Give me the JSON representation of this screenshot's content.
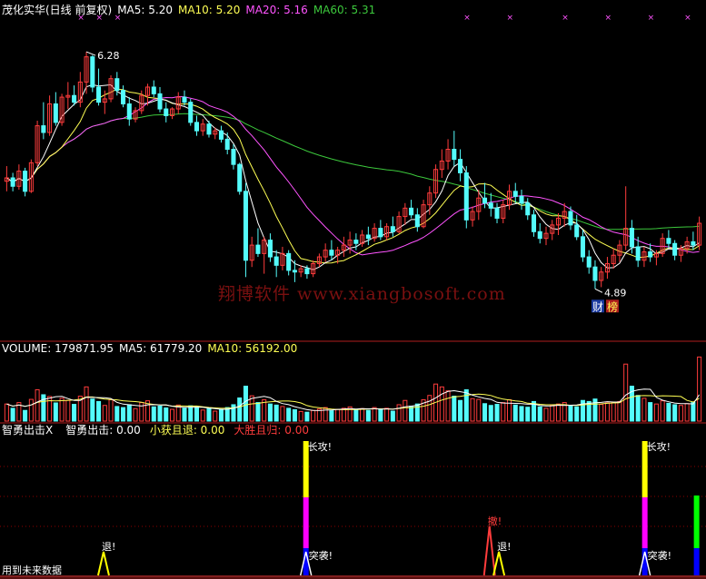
{
  "header": {
    "main": {
      "title": "茂化实华(日线 前复权)",
      "ma5": "MA5: 5.20",
      "ma10": "MA10: 5.20",
      "ma20": "MA20: 5.16",
      "ma60": "MA60: 5.31"
    },
    "volume": {
      "title": "VOLUME: 179871.95",
      "ma5": "MA5: 61779.20",
      "ma10": "MA10: 56192.00"
    },
    "indicator": {
      "title": "智勇出击X",
      "v1": "智勇出击: 0.00",
      "v2": "小获且退: 0.00",
      "v3": "大胜且归: 0.00"
    }
  },
  "watermark": "翔博软件 www.xiangbosoft.com",
  "footer_text": "用到未来数据",
  "colors": {
    "up": "#ff3c3c",
    "down": "#54fcfc",
    "ma5": "#ffffff",
    "ma10": "#ffff54",
    "ma20": "#ff54ff",
    "ma60": "#3cc83c",
    "grid": "#8b0000",
    "divider": "#b01e1e",
    "signal_yellow": "#ffff00",
    "signal_magenta": "#ff00ff",
    "signal_green": "#00ff00",
    "signal_blue": "#0000ff"
  },
  "chart_data": [
    {
      "type": "candlestick",
      "title": "茂化实华(日线 前复权)",
      "ylim": [
        4.6,
        6.5
      ],
      "series_lines": [
        "MA5",
        "MA10",
        "MA20",
        "MA60"
      ],
      "annotations": [
        {
          "text": "6.28",
          "kind": "high_marker",
          "value": 6.28
        },
        {
          "text": "4.89",
          "kind": "low_marker",
          "value": 4.89
        },
        {
          "text": "财",
          "kind": "tag"
        },
        {
          "text": "榜",
          "kind": "tag"
        }
      ],
      "candles_ohlc": [
        [
          5.53,
          5.62,
          5.47,
          5.55
        ],
        [
          5.55,
          5.58,
          5.47,
          5.5
        ],
        [
          5.5,
          5.63,
          5.48,
          5.59
        ],
        [
          5.59,
          5.61,
          5.44,
          5.47
        ],
        [
          5.47,
          5.66,
          5.46,
          5.64
        ],
        [
          5.64,
          5.89,
          5.62,
          5.86
        ],
        [
          5.86,
          6.0,
          5.78,
          5.82
        ],
        [
          5.82,
          6.04,
          5.8,
          5.99
        ],
        [
          5.99,
          6.06,
          5.86,
          5.88
        ],
        [
          5.88,
          6.05,
          5.86,
          6.03
        ],
        [
          6.03,
          6.12,
          5.96,
          6.04
        ],
        [
          6.04,
          6.1,
          5.98,
          6.0
        ],
        [
          6.0,
          6.18,
          5.97,
          6.12
        ],
        [
          6.12,
          6.3,
          6.05,
          6.27
        ],
        [
          6.27,
          6.28,
          6.06,
          6.09
        ],
        [
          6.09,
          6.2,
          5.98,
          6.0
        ],
        [
          6.0,
          6.07,
          5.93,
          6.02
        ],
        [
          6.02,
          6.16,
          6.0,
          6.14
        ],
        [
          6.14,
          6.18,
          6.04,
          6.07
        ],
        [
          6.07,
          6.1,
          5.97,
          5.99
        ],
        [
          5.99,
          6.03,
          5.86,
          5.9
        ],
        [
          5.9,
          5.97,
          5.88,
          5.95
        ],
        [
          5.95,
          6.07,
          5.93,
          6.04
        ],
        [
          6.04,
          6.11,
          5.98,
          6.09
        ],
        [
          6.09,
          6.13,
          6.03,
          6.05
        ],
        [
          6.05,
          6.09,
          5.94,
          5.96
        ],
        [
          5.96,
          6.0,
          5.88,
          5.92
        ],
        [
          5.92,
          5.97,
          5.9,
          5.96
        ],
        [
          5.96,
          6.06,
          5.93,
          6.03
        ],
        [
          6.03,
          6.07,
          5.98,
          6.0
        ],
        [
          6.0,
          6.02,
          5.86,
          5.88
        ],
        [
          5.88,
          5.92,
          5.8,
          5.83
        ],
        [
          5.83,
          5.9,
          5.8,
          5.87
        ],
        [
          5.87,
          5.89,
          5.79,
          5.81
        ],
        [
          5.81,
          5.85,
          5.78,
          5.83
        ],
        [
          5.83,
          5.86,
          5.76,
          5.78
        ],
        [
          5.78,
          5.82,
          5.69,
          5.72
        ],
        [
          5.72,
          5.75,
          5.6,
          5.63
        ],
        [
          5.63,
          5.64,
          5.45,
          5.47
        ],
        [
          5.47,
          5.52,
          4.96,
          5.06
        ],
        [
          5.06,
          5.2,
          5.02,
          5.15
        ],
        [
          5.15,
          5.25,
          5.08,
          5.1
        ],
        [
          5.1,
          5.2,
          4.98,
          5.18
        ],
        [
          5.18,
          5.22,
          5.05,
          5.08
        ],
        [
          5.08,
          5.12,
          4.96,
          5.03
        ],
        [
          5.03,
          5.14,
          5.0,
          5.1
        ],
        [
          5.1,
          5.12,
          4.97,
          5.0
        ],
        [
          5.0,
          5.06,
          4.93,
          4.99
        ],
        [
          4.99,
          5.03,
          4.96,
          5.01
        ],
        [
          5.01,
          5.03,
          4.95,
          4.98
        ],
        [
          4.98,
          5.06,
          4.96,
          5.04
        ],
        [
          5.04,
          5.1,
          5.02,
          5.08
        ],
        [
          5.08,
          5.16,
          5.05,
          5.12
        ],
        [
          5.12,
          5.18,
          5.06,
          5.09
        ],
        [
          5.09,
          5.14,
          5.04,
          5.12
        ],
        [
          5.12,
          5.2,
          5.08,
          5.15
        ],
        [
          5.15,
          5.23,
          5.1,
          5.18
        ],
        [
          5.18,
          5.22,
          5.12,
          5.16
        ],
        [
          5.16,
          5.24,
          5.14,
          5.21
        ],
        [
          5.21,
          5.26,
          5.15,
          5.19
        ],
        [
          5.19,
          5.28,
          5.17,
          5.25
        ],
        [
          5.25,
          5.3,
          5.18,
          5.2
        ],
        [
          5.2,
          5.28,
          5.18,
          5.26
        ],
        [
          5.26,
          5.32,
          5.2,
          5.23
        ],
        [
          5.23,
          5.35,
          5.22,
          5.32
        ],
        [
          5.32,
          5.4,
          5.27,
          5.37
        ],
        [
          5.37,
          5.42,
          5.31,
          5.33
        ],
        [
          5.33,
          5.37,
          5.23,
          5.26
        ],
        [
          5.26,
          5.42,
          5.25,
          5.39
        ],
        [
          5.39,
          5.5,
          5.33,
          5.46
        ],
        [
          5.46,
          5.63,
          5.43,
          5.6
        ],
        [
          5.6,
          5.72,
          5.55,
          5.65
        ],
        [
          5.65,
          5.78,
          5.6,
          5.72
        ],
        [
          5.72,
          5.83,
          5.62,
          5.66
        ],
        [
          5.66,
          5.72,
          5.53,
          5.58
        ],
        [
          5.58,
          5.62,
          5.25,
          5.3
        ],
        [
          5.3,
          5.38,
          5.26,
          5.35
        ],
        [
          5.35,
          5.48,
          5.3,
          5.43
        ],
        [
          5.43,
          5.52,
          5.37,
          5.4
        ],
        [
          5.4,
          5.46,
          5.32,
          5.37
        ],
        [
          5.37,
          5.4,
          5.28,
          5.31
        ],
        [
          5.31,
          5.42,
          5.28,
          5.39
        ],
        [
          5.39,
          5.51,
          5.36,
          5.47
        ],
        [
          5.47,
          5.52,
          5.4,
          5.44
        ],
        [
          5.44,
          5.48,
          5.36,
          5.4
        ],
        [
          5.4,
          5.43,
          5.3,
          5.33
        ],
        [
          5.33,
          5.36,
          5.2,
          5.23
        ],
        [
          5.23,
          5.28,
          5.16,
          5.19
        ],
        [
          5.19,
          5.26,
          5.15,
          5.22
        ],
        [
          5.22,
          5.3,
          5.18,
          5.27
        ],
        [
          5.27,
          5.34,
          5.21,
          5.31
        ],
        [
          5.31,
          5.4,
          5.26,
          5.35
        ],
        [
          5.35,
          5.38,
          5.24,
          5.27
        ],
        [
          5.27,
          5.33,
          5.18,
          5.2
        ],
        [
          5.2,
          5.24,
          5.05,
          5.08
        ],
        [
          5.08,
          5.12,
          4.98,
          5.02
        ],
        [
          5.02,
          5.06,
          4.89,
          4.94
        ],
        [
          4.94,
          5.02,
          4.9,
          4.99
        ],
        [
          4.99,
          5.08,
          4.95,
          5.04
        ],
        [
          5.04,
          5.13,
          5.01,
          5.09
        ],
        [
          5.09,
          5.18,
          5.05,
          5.15
        ],
        [
          5.15,
          5.5,
          5.12,
          5.25
        ],
        [
          5.25,
          5.3,
          5.1,
          5.14
        ],
        [
          5.14,
          5.2,
          5.02,
          5.06
        ],
        [
          5.06,
          5.14,
          5.02,
          5.11
        ],
        [
          5.11,
          5.16,
          5.05,
          5.08
        ],
        [
          5.08,
          5.12,
          5.03,
          5.1
        ],
        [
          5.1,
          5.22,
          5.08,
          5.19
        ],
        [
          5.19,
          5.24,
          5.13,
          5.16
        ],
        [
          5.16,
          5.18,
          5.06,
          5.09
        ],
        [
          5.09,
          5.15,
          5.05,
          5.13
        ],
        [
          5.13,
          5.2,
          5.1,
          5.17
        ],
        [
          5.17,
          5.23,
          5.12,
          5.15
        ],
        [
          5.15,
          5.32,
          5.12,
          5.28
        ]
      ]
    },
    {
      "type": "bar",
      "title": "VOLUME: 179871.95",
      "series_lines": [
        "MA5",
        "MA10"
      ],
      "values": [
        48000,
        36000,
        52000,
        30000,
        61000,
        88000,
        74000,
        69000,
        51000,
        64000,
        58000,
        47000,
        70000,
        96000,
        62000,
        55000,
        44000,
        60000,
        41000,
        38000,
        46000,
        35000,
        52000,
        57000,
        40000,
        42000,
        37000,
        33000,
        45000,
        36000,
        43000,
        39000,
        31000,
        35000,
        28000,
        33000,
        38000,
        46000,
        65000,
        98000,
        71000,
        52000,
        60000,
        48000,
        45000,
        41000,
        36000,
        32000,
        27000,
        25000,
        30000,
        34000,
        38000,
        29000,
        33000,
        36000,
        40000,
        31000,
        35000,
        30000,
        38000,
        33000,
        36000,
        28000,
        46000,
        58000,
        42000,
        48000,
        60000,
        72000,
        104000,
        96000,
        85000,
        70000,
        58000,
        88000,
        63000,
        61000,
        49000,
        44000,
        47000,
        52000,
        60000,
        45000,
        41000,
        39000,
        55000,
        40000,
        36000,
        44000,
        48000,
        52000,
        43000,
        40000,
        58000,
        55000,
        62000,
        47000,
        51000,
        53000,
        55000,
        160000,
        98000,
        72000,
        64000,
        52000,
        48000,
        57000,
        50000,
        46000,
        44000,
        49000,
        52000,
        179871.95
      ]
    },
    {
      "type": "signal",
      "title": "智勇出击X",
      "series": [
        {
          "name": "智勇出击",
          "value": 0.0
        },
        {
          "name": "小获且退",
          "value": 0.0
        },
        {
          "name": "大胜且归",
          "value": 0.0
        }
      ],
      "signals": [
        {
          "index": 22,
          "label": "退!",
          "kind": "triangle",
          "color": "yellow"
        },
        {
          "index": 65,
          "label": "长攻!",
          "kind": "column",
          "segments": [
            "yellow",
            "magenta"
          ],
          "sub_label": "突袭!",
          "sub_kind": "triangle",
          "sub_color": "blue"
        },
        {
          "index": 104,
          "label": "撤!",
          "kind": "triangle",
          "color": "red"
        },
        {
          "index": 106,
          "label": "退!",
          "kind": "triangle",
          "color": "yellow"
        },
        {
          "index": 137,
          "label": "长攻!",
          "kind": "column",
          "segments": [
            "yellow",
            "magenta"
          ],
          "sub_label": "突袭!",
          "sub_kind": "triangle",
          "sub_color": "blue"
        },
        {
          "index": 148,
          "label": "",
          "kind": "column",
          "segments": [
            "green",
            "blue"
          ]
        }
      ],
      "footer": "用到未来数据"
    }
  ]
}
